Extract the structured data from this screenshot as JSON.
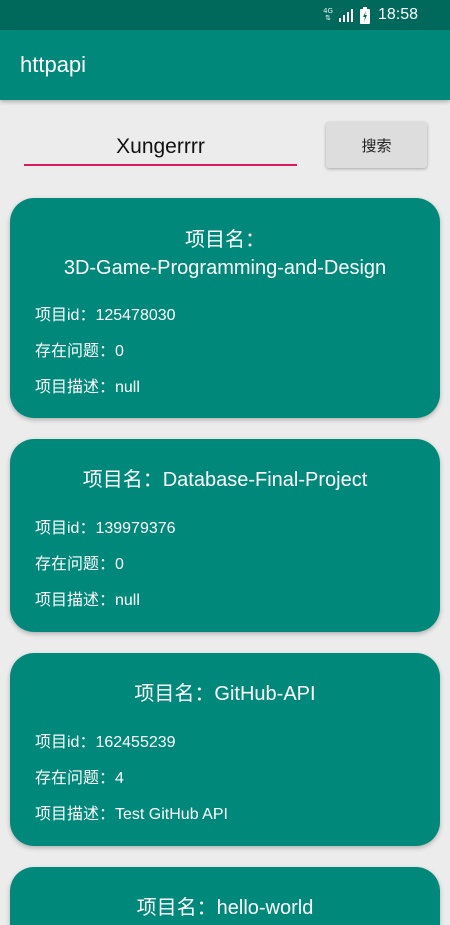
{
  "status_bar": {
    "network": "4G",
    "time": "18:58",
    "icons": [
      "network-4g-icon",
      "signal-icon",
      "battery-icon"
    ]
  },
  "app_bar": {
    "title": "httpapi"
  },
  "search": {
    "input_value": "Xungerrrr",
    "button_label": "搜索"
  },
  "colors": {
    "primary": "#00897b",
    "primary_dark": "#00695c",
    "accent": "#d81b60",
    "background": "#ececec"
  },
  "repos": [
    {
      "title_line1": "项目名：",
      "title_line2": "3D-Game-Programming-and-Design",
      "id_line": "项目id：125478030",
      "issues_line": "存在问题：0",
      "desc_line": "项目描述：null"
    },
    {
      "title_line1": "项目名：Database-Final-Project",
      "id_line": "项目id：139979376",
      "issues_line": "存在问题：0",
      "desc_line": "项目描述：null"
    },
    {
      "title_line1": "项目名：GitHub-API",
      "id_line": "项目id：162455239",
      "issues_line": "存在问题：4",
      "desc_line": "项目描述：Test GitHub API"
    },
    {
      "title_line1": "项目名：hello-world"
    }
  ]
}
